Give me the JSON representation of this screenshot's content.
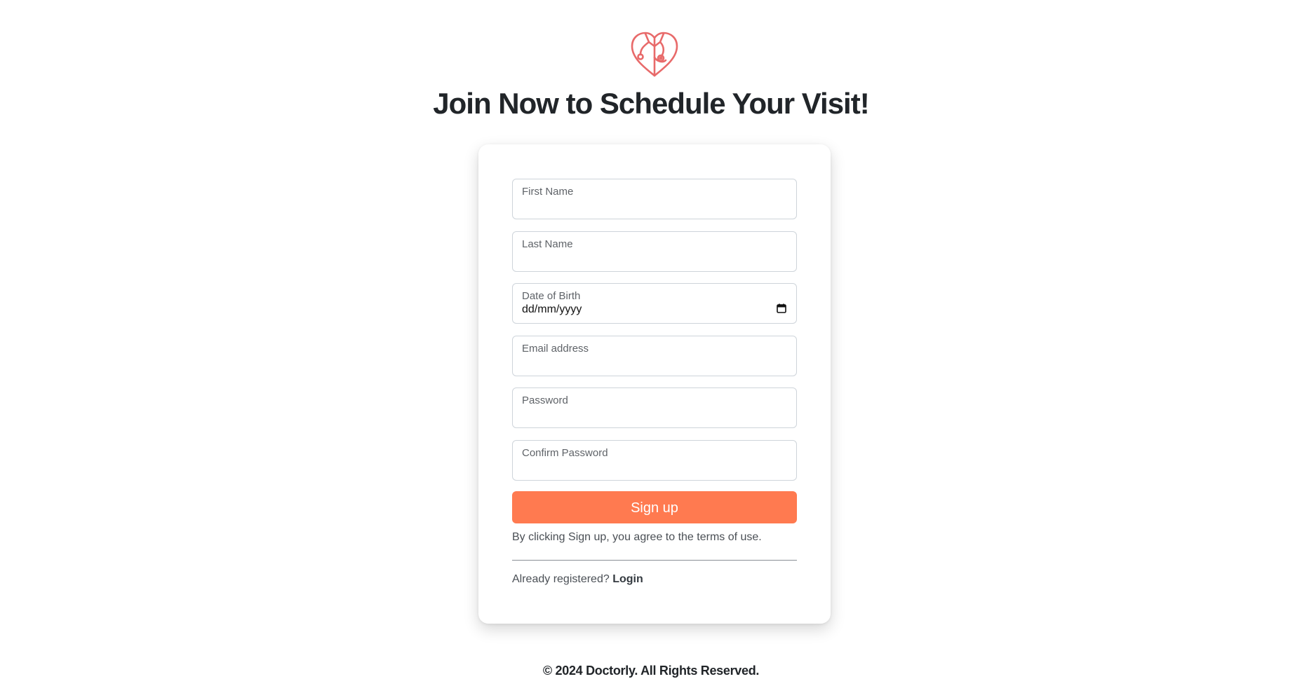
{
  "header": {
    "logo_icon": "heart-stethoscope-icon",
    "brand_color": "#e86a6a",
    "title": "Join Now to Schedule Your Visit!"
  },
  "form": {
    "first_name": {
      "label": "First Name",
      "value": ""
    },
    "last_name": {
      "label": "Last Name",
      "value": ""
    },
    "dob": {
      "label": "Date of Birth",
      "value": "dd/mm/yyyy",
      "icon": "calendar-icon"
    },
    "email": {
      "label": "Email address",
      "value": ""
    },
    "password": {
      "label": "Password",
      "value": ""
    },
    "confirm_password": {
      "label": "Confirm Password",
      "value": ""
    },
    "signup_label": "Sign up",
    "signup_color": "#ff7a50",
    "terms_text": "By clicking Sign up, you agree to the terms of use.",
    "already_text": "Already registered?",
    "login_label": "Login"
  },
  "footer": {
    "copyright": "© 2024 Doctorly. All Rights Reserved."
  }
}
